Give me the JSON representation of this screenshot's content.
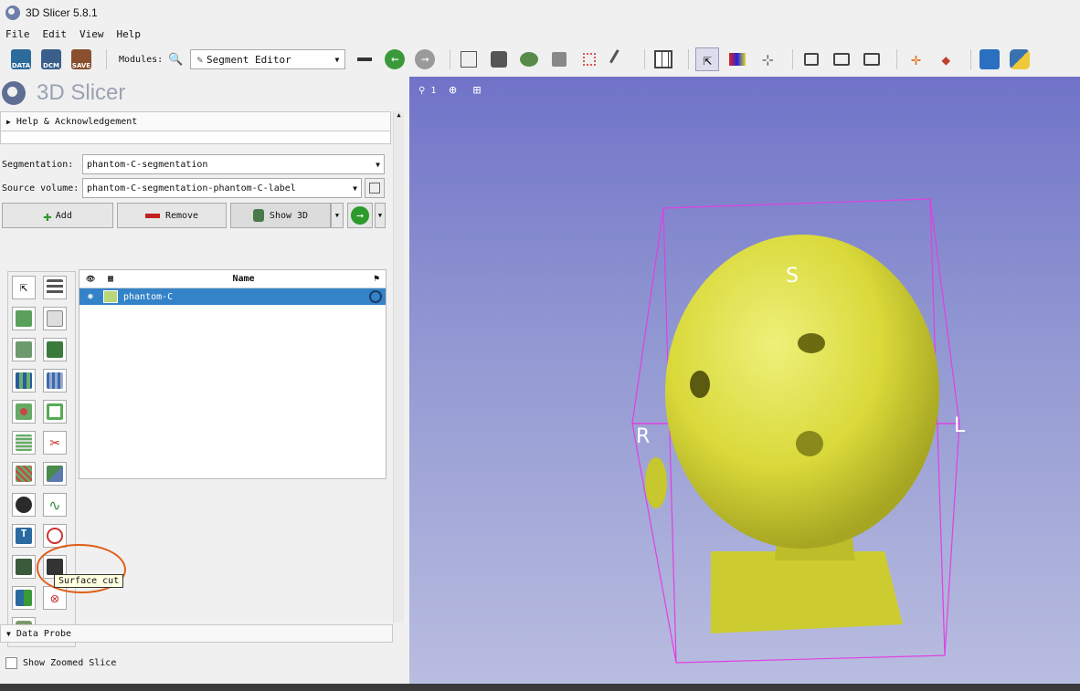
{
  "window": {
    "title": "3D Slicer 5.8.1"
  },
  "menu": [
    "File",
    "Edit",
    "View",
    "Help"
  ],
  "toolbar": {
    "data_label": "DATA",
    "dcm_label": "DCM",
    "save_label": "SAVE",
    "modules_label": "Modules:",
    "module_selected": "Segment Editor"
  },
  "sidebar": {
    "brand": "3D Slicer",
    "help_section": "Help & Acknowledgement",
    "segmentation_label": "Segmentation:",
    "segmentation_value": "phantom-C-segmentation",
    "source_label": "Source volume:",
    "source_value": "phantom-C-segmentation-phantom-C-label",
    "add_label": "Add",
    "remove_label": "Remove",
    "show3d_label": "Show 3D",
    "table": {
      "name_header": "Name",
      "rows": [
        {
          "name": "phantom-C",
          "color": "#b8d67a",
          "selected": true
        }
      ]
    },
    "tooltip": "Surface cut",
    "data_probe": "Data Probe",
    "show_zoomed_slice": "Show Zoomed Slice"
  },
  "viewer": {
    "view_index": "1",
    "orientation": {
      "superior": "S",
      "right": "R",
      "left": "L"
    },
    "model_color": "#d9d93a",
    "bbox_color": "#e040e0"
  },
  "colors": {
    "selection": "#3483c9",
    "highlight_circle": "#e0601a"
  }
}
